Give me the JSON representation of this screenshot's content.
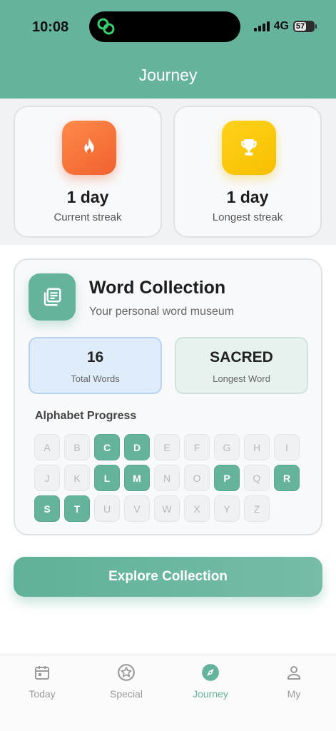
{
  "status_bar": {
    "time": "10:08",
    "network": "4G",
    "battery": "57"
  },
  "header": {
    "title": "Journey"
  },
  "streaks": {
    "current": {
      "value": "1 day",
      "label": "Current streak",
      "icon": "fire-icon"
    },
    "longest": {
      "value": "1 day",
      "label": "Longest streak",
      "icon": "trophy-icon"
    }
  },
  "word_collection": {
    "icon": "library-icon",
    "title": "Word Collection",
    "subtitle": "Your personal word museum",
    "total_words": {
      "value": "16",
      "label": "Total Words"
    },
    "longest_word": {
      "value": "SACRED",
      "label": "Longest Word"
    },
    "alphabet_heading": "Alphabet Progress",
    "letters": [
      {
        "letter": "A",
        "collected": false
      },
      {
        "letter": "B",
        "collected": false
      },
      {
        "letter": "C",
        "collected": true
      },
      {
        "letter": "D",
        "collected": true
      },
      {
        "letter": "E",
        "collected": false
      },
      {
        "letter": "F",
        "collected": false
      },
      {
        "letter": "G",
        "collected": false
      },
      {
        "letter": "H",
        "collected": false
      },
      {
        "letter": "I",
        "collected": false
      },
      {
        "letter": "J",
        "collected": false
      },
      {
        "letter": "K",
        "collected": false
      },
      {
        "letter": "L",
        "collected": true
      },
      {
        "letter": "M",
        "collected": true
      },
      {
        "letter": "N",
        "collected": false
      },
      {
        "letter": "O",
        "collected": false
      },
      {
        "letter": "P",
        "collected": true
      },
      {
        "letter": "Q",
        "collected": false
      },
      {
        "letter": "R",
        "collected": true
      },
      {
        "letter": "S",
        "collected": true
      },
      {
        "letter": "T",
        "collected": true
      },
      {
        "letter": "U",
        "collected": false
      },
      {
        "letter": "V",
        "collected": false
      },
      {
        "letter": "W",
        "collected": false
      },
      {
        "letter": "X",
        "collected": false
      },
      {
        "letter": "Y",
        "collected": false
      },
      {
        "letter": "Z",
        "collected": false
      }
    ]
  },
  "explore_button": {
    "label": "Explore Collection"
  },
  "tabs": [
    {
      "label": "Today",
      "icon": "calendar-icon",
      "active": false
    },
    {
      "label": "Special",
      "icon": "star-badge-icon",
      "active": false
    },
    {
      "label": "Journey",
      "icon": "compass-icon",
      "active": true
    },
    {
      "label": "My",
      "icon": "person-icon",
      "active": false
    }
  ],
  "colors": {
    "accent": "#65b39d",
    "fire": "#f0612e",
    "trophy": "#f7bf00",
    "inactive_tab": "#9a9a9a"
  }
}
